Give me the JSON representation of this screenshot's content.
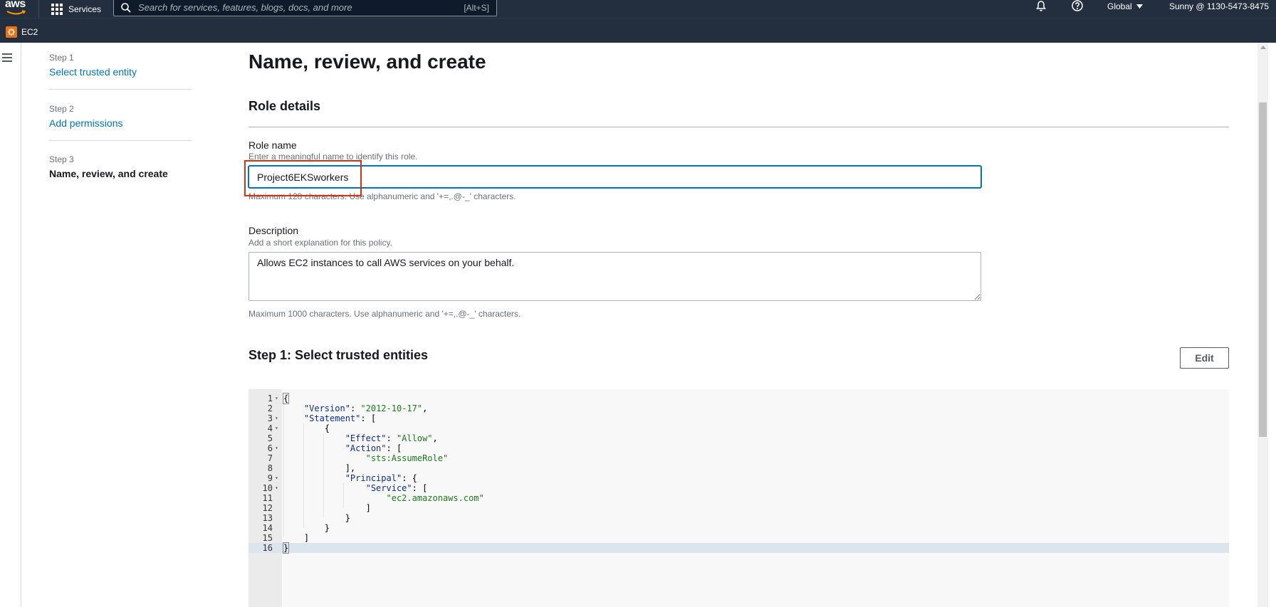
{
  "topnav": {
    "logo_text": "aws",
    "services_label": "Services",
    "search_placeholder": "Search for services, features, blogs, docs, and more",
    "search_shortcut": "[Alt+S]",
    "region_label": "Global",
    "account_label": "Sunny @ 1130-5473-8475"
  },
  "subnav": {
    "service_label": "EC2"
  },
  "steps": [
    {
      "number": "Step 1",
      "label": "Select trusted entity"
    },
    {
      "number": "Step 2",
      "label": "Add permissions"
    },
    {
      "number": "Step 3",
      "label": "Name, review, and create"
    }
  ],
  "main": {
    "page_title": "Name, review, and create",
    "section_title": "Role details",
    "role_name": {
      "label": "Role name",
      "description": "Enter a meaningful name to identify this role.",
      "value": "Project6EKSworkers",
      "constraint": "Maximum 128 characters. Use alphanumeric and '+=,.@-_' characters."
    },
    "description": {
      "label": "Description",
      "description": "Add a short explanation for this policy.",
      "value": "Allows EC2 instances to call AWS services on your behalf.",
      "constraint": "Maximum 1000 characters. Use alphanumeric and '+=,.@-_' characters."
    },
    "trusted_entities": {
      "title": "Step 1: Select trusted entities",
      "edit_label": "Edit"
    }
  },
  "policy_code": [
    {
      "n": "1",
      "fold": true,
      "text": "{"
    },
    {
      "n": "2",
      "fold": false,
      "text": "    \"Version\": \"2012-10-17\","
    },
    {
      "n": "3",
      "fold": true,
      "text": "    \"Statement\": ["
    },
    {
      "n": "4",
      "fold": true,
      "text": "        {"
    },
    {
      "n": "5",
      "fold": false,
      "text": "            \"Effect\": \"Allow\","
    },
    {
      "n": "6",
      "fold": true,
      "text": "            \"Action\": ["
    },
    {
      "n": "7",
      "fold": false,
      "text": "                \"sts:AssumeRole\""
    },
    {
      "n": "8",
      "fold": false,
      "text": "            ],"
    },
    {
      "n": "9",
      "fold": true,
      "text": "            \"Principal\": {"
    },
    {
      "n": "10",
      "fold": true,
      "text": "                \"Service\": ["
    },
    {
      "n": "11",
      "fold": false,
      "text": "                    \"ec2.amazonaws.com\""
    },
    {
      "n": "12",
      "fold": false,
      "text": "                ]"
    },
    {
      "n": "13",
      "fold": false,
      "text": "            }"
    },
    {
      "n": "14",
      "fold": false,
      "text": "        }"
    },
    {
      "n": "15",
      "fold": false,
      "text": "    ]"
    },
    {
      "n": "16",
      "fold": false,
      "text": "}"
    }
  ],
  "active_code_line": "16",
  "colors": {
    "nav_bg": "#232f3e",
    "link": "#0073bb",
    "highlight_box": "#d13212",
    "ec2_orange": "#e8731a"
  }
}
